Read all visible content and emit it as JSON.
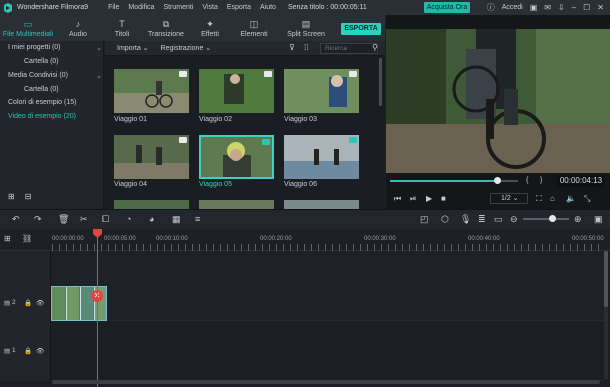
{
  "titlebar": {
    "app_title": "Wondershare Filmora9",
    "menu": [
      "File",
      "Modifica",
      "Strumenti",
      "Vista",
      "Esporta",
      "Aiuto"
    ],
    "doc_title": "Senza titolo : 00:00:05:11",
    "buy_label": "Acquista Ora",
    "login_label": "Accedi"
  },
  "toolbar": {
    "tabs": [
      {
        "label": "File Multimediali",
        "icon": "folder-icon"
      },
      {
        "label": "Audio",
        "icon": "music-note-icon"
      },
      {
        "label": "Titoli",
        "icon": "text-icon"
      },
      {
        "label": "Transizione",
        "icon": "transition-icon"
      },
      {
        "label": "Effetti",
        "icon": "effects-icon"
      },
      {
        "label": "Elementi",
        "icon": "elements-icon"
      },
      {
        "label": "Split Screen",
        "icon": "split-screen-icon"
      }
    ],
    "export_label": "ESPORTA"
  },
  "sidebar": {
    "items": [
      {
        "label": "I miei progetti (0)"
      },
      {
        "label": "Cartella (0)"
      },
      {
        "label": "Media Condivisi (0)"
      },
      {
        "label": "Cartella (0)"
      },
      {
        "label": "Colori di esempio (15)"
      },
      {
        "label": "Video di esempio (20)"
      }
    ]
  },
  "media": {
    "import_label": "Importa",
    "record_label": "Registrazione",
    "search_placeholder": "Ricerca",
    "items": [
      {
        "label": "Viaggio 01"
      },
      {
        "label": "Viaggio 02"
      },
      {
        "label": "Viaggio 03"
      },
      {
        "label": "Viaggio 04"
      },
      {
        "label": "Viaggio 05"
      },
      {
        "label": "Viaggio 06"
      }
    ]
  },
  "preview": {
    "timecode": "00:00:04:13",
    "ratio": "1/2",
    "progress": 0.86
  },
  "timeline": {
    "ruler": [
      "00:00:00:00",
      "00:00:05:00",
      "00:00:10:00",
      "00:00:20:00",
      "00:00:30:00",
      "00:00:40:00",
      "00:00:50:00"
    ],
    "tracks": [
      {
        "label": "2"
      },
      {
        "label": "1"
      }
    ]
  },
  "colors": {
    "accent": "#2fc4b6",
    "playhead": "#e0463e",
    "buy": "#23b8a8"
  }
}
